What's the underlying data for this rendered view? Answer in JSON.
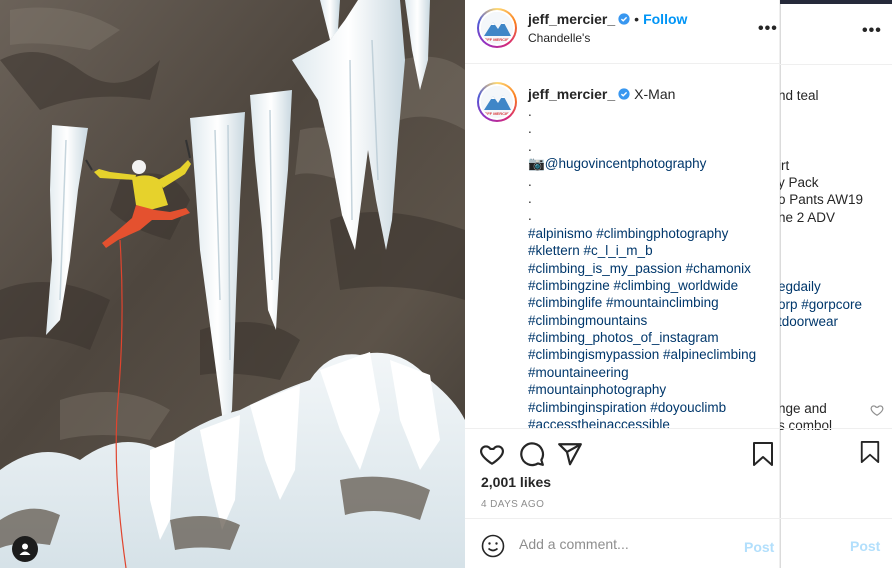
{
  "post": {
    "username": "jeff_mercier_",
    "verified": true,
    "follow_label": "Follow",
    "separator": "•",
    "location": "Chandelle's",
    "more_label": "•••",
    "avatar_badge_text": "JEFF MERCIER",
    "caption": {
      "title": "X-Man",
      "lines": [
        {
          "text": ".",
          "type": "plain"
        },
        {
          "text": ".",
          "type": "plain"
        },
        {
          "text": ".",
          "type": "plain"
        },
        {
          "text": "📷@hugovincentphotography",
          "type": "tag"
        },
        {
          "text": ".",
          "type": "plain"
        },
        {
          "text": ".",
          "type": "plain"
        },
        {
          "text": ".",
          "type": "plain"
        },
        {
          "text": "#alpinismo #climbingphotography",
          "type": "tag"
        },
        {
          "text": "#klettern #c_l_i_m_b",
          "type": "tag"
        },
        {
          "text": "#climbing_is_my_passion #chamonix",
          "type": "tag"
        },
        {
          "text": "#climbingzine #climbing_worldwide",
          "type": "tag"
        },
        {
          "text": "#climbinglife #mountainclimbing",
          "type": "tag"
        },
        {
          "text": "#climbingmountains",
          "type": "tag"
        },
        {
          "text": "#climbing_photos_of_instagram",
          "type": "tag"
        },
        {
          "text": "#climbingismypassion #alpineclimbing",
          "type": "tag"
        },
        {
          "text": "#mountaineering",
          "type": "tag"
        },
        {
          "text": "#mountainphotography",
          "type": "tag"
        },
        {
          "text": "#climbinginspiration #doyouclimb",
          "type": "tag"
        },
        {
          "text": "#accesstheinaccessible",
          "type": "tag"
        }
      ]
    },
    "likes": "2,001 likes",
    "posted_ago": "4 DAYS AGO",
    "comment_placeholder": "Add a comment...",
    "post_label": "Post",
    "icons": [
      "heart-icon",
      "comment-icon",
      "share-icon",
      "bookmark-icon",
      "emoji-icon",
      "verified-badge-icon",
      "user-tag-icon"
    ],
    "colors": {
      "link": "#00376b",
      "follow": "#0095f6",
      "post_disabled": "#b2dffc",
      "muted": "#8e8e8e"
    }
  },
  "background_post": {
    "more_label": "•••",
    "lines": [
      {
        "text": "nd teal",
        "type": "plain"
      },
      {
        "text": "",
        "type": "plain"
      },
      {
        "text": "",
        "type": "plain"
      },
      {
        "text": "",
        "type": "plain"
      },
      {
        "text": "irt",
        "type": "plain"
      },
      {
        "text": "y Pack",
        "type": "plain"
      },
      {
        "text": "o Pants AW19",
        "type": "plain"
      },
      {
        "text": "ne 2 ADV",
        "type": "plain"
      },
      {
        "text": "",
        "type": "plain"
      },
      {
        "text": "",
        "type": "plain"
      },
      {
        "text": "",
        "type": "plain"
      },
      {
        "text": "egdaily",
        "type": "tag"
      },
      {
        "text": "orp #gorpcore",
        "type": "tag"
      },
      {
        "text": "tdoorwear",
        "type": "tag"
      },
      {
        "text": "",
        "type": "plain"
      },
      {
        "text": "",
        "type": "plain"
      },
      {
        "text": "",
        "type": "plain"
      },
      {
        "text": "",
        "type": "plain"
      },
      {
        "text": "nge and",
        "type": "plain"
      },
      {
        "text": "s combol",
        "type": "plain"
      }
    ],
    "post_label": "Post"
  }
}
